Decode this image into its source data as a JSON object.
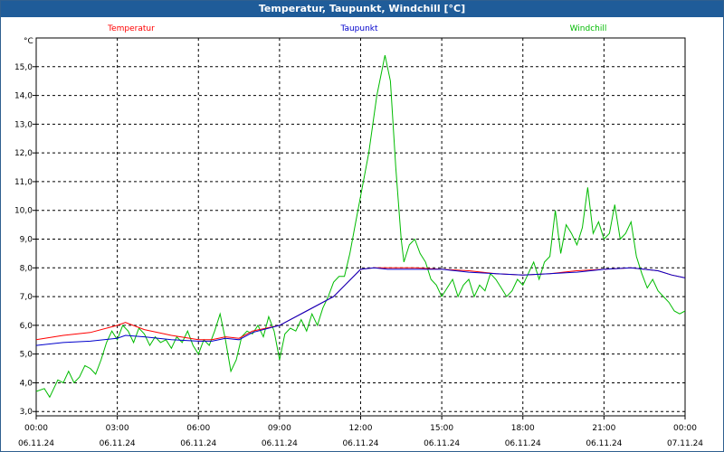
{
  "window": {
    "title": "Temperatur, Taupunkt, Windchill [°C]"
  },
  "chart_data": {
    "type": "line",
    "title": "Temperatur, Taupunkt, Windchill [°C]",
    "ylabel": "°C",
    "xlabel": "",
    "ylim": [
      2.85,
      16.0
    ],
    "xlim_hours": [
      0,
      24
    ],
    "grid": true,
    "legend_placement": "top",
    "y_ticks": [
      "3,0",
      "4,0",
      "5,0",
      "6,0",
      "7,0",
      "8,0",
      "9,0",
      "10,0",
      "11,0",
      "12,0",
      "13,0",
      "14,0",
      "15,0"
    ],
    "x_ticks": [
      {
        "time": "00:00",
        "date": "06.11.24"
      },
      {
        "time": "03:00",
        "date": "06.11.24"
      },
      {
        "time": "06:00",
        "date": "06.11.24"
      },
      {
        "time": "09:00",
        "date": "06.11.24"
      },
      {
        "time": "12:00",
        "date": "06.11.24"
      },
      {
        "time": "15:00",
        "date": "06.11.24"
      },
      {
        "time": "18:00",
        "date": "06.11.24"
      },
      {
        "time": "21:00",
        "date": "06.11.24"
      },
      {
        "time": "00:00",
        "date": "07.11.24"
      }
    ],
    "series": [
      {
        "name": "Temperatur",
        "color": "#ff0000",
        "points": [
          [
            0,
            5.5
          ],
          [
            1,
            5.65
          ],
          [
            2,
            5.75
          ],
          [
            3,
            6.0
          ],
          [
            3.3,
            6.1
          ],
          [
            4,
            5.85
          ],
          [
            5,
            5.65
          ],
          [
            6,
            5.5
          ],
          [
            6.5,
            5.5
          ],
          [
            7,
            5.6
          ],
          [
            7.5,
            5.55
          ],
          [
            8,
            5.8
          ],
          [
            9,
            6.0
          ],
          [
            10,
            6.5
          ],
          [
            11,
            7.0
          ],
          [
            12,
            7.95
          ],
          [
            12.5,
            8.0
          ],
          [
            13,
            8.0
          ],
          [
            14,
            8.0
          ],
          [
            15,
            7.95
          ],
          [
            16,
            7.9
          ],
          [
            17,
            7.8
          ],
          [
            18,
            7.75
          ],
          [
            19,
            7.8
          ],
          [
            20,
            7.9
          ],
          [
            21,
            7.95
          ],
          [
            22,
            8.0
          ],
          [
            23,
            7.9
          ],
          [
            23.5,
            7.75
          ],
          [
            24,
            7.65
          ]
        ]
      },
      {
        "name": "Taupunkt",
        "color": "#0000cc",
        "points": [
          [
            0,
            5.3
          ],
          [
            1,
            5.4
          ],
          [
            2,
            5.45
          ],
          [
            3,
            5.55
          ],
          [
            3.3,
            5.65
          ],
          [
            4,
            5.6
          ],
          [
            5,
            5.5
          ],
          [
            6,
            5.45
          ],
          [
            6.5,
            5.45
          ],
          [
            7,
            5.55
          ],
          [
            7.5,
            5.5
          ],
          [
            8,
            5.75
          ],
          [
            9,
            6.0
          ],
          [
            10,
            6.5
          ],
          [
            11,
            7.0
          ],
          [
            12,
            7.95
          ],
          [
            12.5,
            8.0
          ],
          [
            13,
            7.95
          ],
          [
            14,
            7.95
          ],
          [
            15,
            7.95
          ],
          [
            16,
            7.85
          ],
          [
            17,
            7.8
          ],
          [
            18,
            7.75
          ],
          [
            19,
            7.8
          ],
          [
            20,
            7.85
          ],
          [
            21,
            7.95
          ],
          [
            22,
            8.0
          ],
          [
            23,
            7.9
          ],
          [
            23.5,
            7.75
          ],
          [
            24,
            7.65
          ]
        ]
      },
      {
        "name": "Windchill",
        "color": "#00bb00",
        "points": [
          [
            0,
            3.7
          ],
          [
            0.3,
            3.8
          ],
          [
            0.5,
            3.5
          ],
          [
            0.8,
            4.1
          ],
          [
            1.0,
            4.0
          ],
          [
            1.2,
            4.4
          ],
          [
            1.4,
            4.0
          ],
          [
            1.6,
            4.2
          ],
          [
            1.8,
            4.6
          ],
          [
            2.0,
            4.5
          ],
          [
            2.2,
            4.3
          ],
          [
            2.4,
            4.8
          ],
          [
            2.6,
            5.4
          ],
          [
            2.8,
            5.8
          ],
          [
            3.0,
            5.5
          ],
          [
            3.2,
            6.0
          ],
          [
            3.4,
            5.8
          ],
          [
            3.6,
            5.4
          ],
          [
            3.8,
            5.9
          ],
          [
            4.0,
            5.7
          ],
          [
            4.2,
            5.3
          ],
          [
            4.4,
            5.6
          ],
          [
            4.6,
            5.4
          ],
          [
            4.8,
            5.5
          ],
          [
            5.0,
            5.2
          ],
          [
            5.2,
            5.6
          ],
          [
            5.4,
            5.4
          ],
          [
            5.6,
            5.8
          ],
          [
            5.8,
            5.3
          ],
          [
            6.0,
            5.0
          ],
          [
            6.2,
            5.5
          ],
          [
            6.4,
            5.3
          ],
          [
            6.6,
            5.8
          ],
          [
            6.8,
            6.4
          ],
          [
            7.0,
            5.5
          ],
          [
            7.2,
            4.4
          ],
          [
            7.4,
            4.8
          ],
          [
            7.6,
            5.6
          ],
          [
            7.8,
            5.8
          ],
          [
            8.0,
            5.7
          ],
          [
            8.2,
            6.0
          ],
          [
            8.4,
            5.6
          ],
          [
            8.6,
            6.3
          ],
          [
            8.8,
            5.8
          ],
          [
            9.0,
            4.8
          ],
          [
            9.2,
            5.7
          ],
          [
            9.4,
            5.9
          ],
          [
            9.6,
            5.8
          ],
          [
            9.8,
            6.2
          ],
          [
            10.0,
            5.8
          ],
          [
            10.2,
            6.4
          ],
          [
            10.4,
            6.0
          ],
          [
            10.6,
            6.6
          ],
          [
            10.8,
            7.0
          ],
          [
            11.0,
            7.5
          ],
          [
            11.2,
            7.7
          ],
          [
            11.4,
            7.7
          ],
          [
            11.6,
            8.5
          ],
          [
            11.8,
            9.5
          ],
          [
            12.0,
            10.5
          ],
          [
            12.3,
            12.0
          ],
          [
            12.6,
            14.0
          ],
          [
            12.9,
            15.4
          ],
          [
            13.1,
            14.5
          ],
          [
            13.3,
            11.5
          ],
          [
            13.5,
            9.0
          ],
          [
            13.6,
            8.2
          ],
          [
            13.8,
            8.8
          ],
          [
            14.0,
            9.0
          ],
          [
            14.2,
            8.5
          ],
          [
            14.4,
            8.2
          ],
          [
            14.6,
            7.6
          ],
          [
            14.8,
            7.4
          ],
          [
            15.0,
            7.0
          ],
          [
            15.2,
            7.3
          ],
          [
            15.4,
            7.6
          ],
          [
            15.6,
            7.0
          ],
          [
            15.8,
            7.4
          ],
          [
            16.0,
            7.6
          ],
          [
            16.2,
            7.0
          ],
          [
            16.4,
            7.4
          ],
          [
            16.6,
            7.2
          ],
          [
            16.8,
            7.8
          ],
          [
            17.0,
            7.6
          ],
          [
            17.2,
            7.3
          ],
          [
            17.4,
            7.0
          ],
          [
            17.6,
            7.2
          ],
          [
            17.8,
            7.6
          ],
          [
            18.0,
            7.4
          ],
          [
            18.2,
            7.8
          ],
          [
            18.4,
            8.2
          ],
          [
            18.6,
            7.6
          ],
          [
            18.8,
            8.2
          ],
          [
            19.0,
            8.4
          ],
          [
            19.2,
            10.0
          ],
          [
            19.4,
            8.5
          ],
          [
            19.6,
            9.5
          ],
          [
            19.8,
            9.2
          ],
          [
            20.0,
            8.8
          ],
          [
            20.2,
            9.4
          ],
          [
            20.4,
            10.8
          ],
          [
            20.6,
            9.2
          ],
          [
            20.8,
            9.6
          ],
          [
            21.0,
            9.0
          ],
          [
            21.2,
            9.2
          ],
          [
            21.4,
            10.2
          ],
          [
            21.6,
            9.0
          ],
          [
            21.8,
            9.2
          ],
          [
            22.0,
            9.6
          ],
          [
            22.2,
            8.4
          ],
          [
            22.4,
            7.8
          ],
          [
            22.6,
            7.3
          ],
          [
            22.8,
            7.6
          ],
          [
            23.0,
            7.2
          ],
          [
            23.2,
            7.0
          ],
          [
            23.4,
            6.8
          ],
          [
            23.6,
            6.5
          ],
          [
            23.8,
            6.4
          ],
          [
            24.0,
            6.5
          ]
        ]
      }
    ]
  }
}
